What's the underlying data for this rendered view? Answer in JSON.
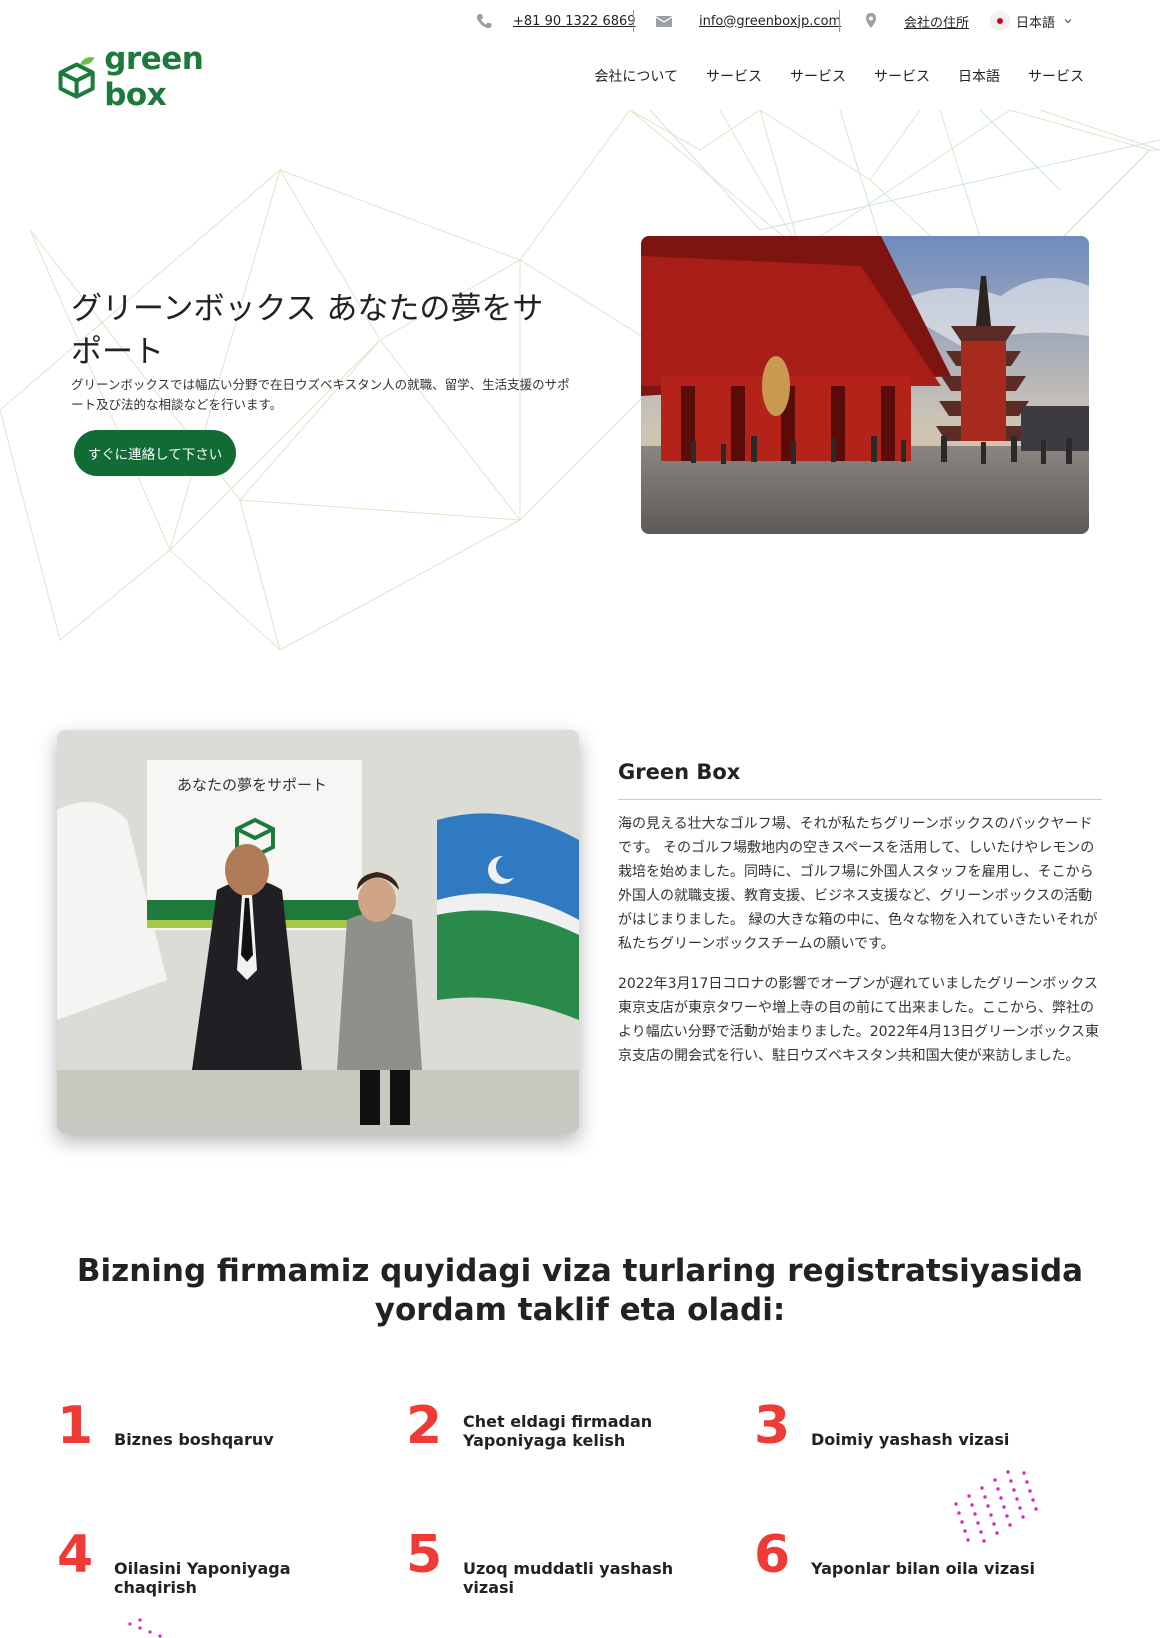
{
  "topbar": {
    "phone": "+81 90 1322 6869",
    "email": "info@greenboxjp.com",
    "address": "会社の住所",
    "language": "日本語"
  },
  "logo": {
    "text": "green box"
  },
  "nav": {
    "items": [
      "会社について",
      "サービス",
      "サービス",
      "サービス",
      "日本語",
      "サービス"
    ]
  },
  "hero": {
    "title": "グリーンボックス あなたの夢をサポート",
    "subtitle": "グリーンボックスでは幅広い分野で在日ウズベキスタン人の就職、留学、生活支援のサポート及び法的な相談などを行います。",
    "cta": "すぐに連絡して下さい"
  },
  "about": {
    "banner_text": "あなたの夢をサポート",
    "title": "Green Box",
    "p1": "海の見える壮大なゴルフ場、それが私たちグリーンボックスのバックヤードです。 そのゴルフ場敷地内の空きスペースを活用して、しいたけやレモンの栽培を始めました。同時に、ゴルフ場に外国人スタッフを雇用し、そこから外国人の就職支援、教育支援、ビジネス支援など、グリーンボックスの活動がはじまりました。 緑の大きな箱の中に、色々な物を入れていきたいそれが私たちグリーンボックスチームの願いです。",
    "p2": "2022年3月17日コロナの影響でオープンが遅れていましたグリーンボックス東京支店が東京タワーや増上寺の目の前にて出来ました。ここから、弊社のより幅広い分野で活動が始まりました。2022年4月13日グリーンボックス東京支店の開会式を行い、駐日ウズベキスタン共和国大使が来訪しました。"
  },
  "viza": {
    "title": "Bizning firmamiz quyidagi viza turlaring registratsiyasida yordam taklif eta oladi:",
    "items": [
      {
        "num": "1",
        "label": "Biznes boshqaruv"
      },
      {
        "num": "2",
        "label": "Chet eldagi firmadan Yaponiyaga kelish"
      },
      {
        "num": "3",
        "label": "Doimiy yashash vizasi"
      },
      {
        "num": "4",
        "label": "Oilasini Yaponiyaga chaqirish"
      },
      {
        "num": "5",
        "label": "Uzoq muddatli yashash vizasi"
      },
      {
        "num": "6",
        "label": "Yaponlar bilan oila vizasi"
      }
    ]
  },
  "colors": {
    "brand_green": "#106b35",
    "logo_green": "#1e7a3c",
    "number_red": "#ef3b36",
    "dots_magenta": "#e020c8"
  },
  "icons": [
    "phone-icon",
    "mail-icon",
    "location-pin-icon",
    "japan-flag-icon",
    "chevron-down-icon"
  ]
}
